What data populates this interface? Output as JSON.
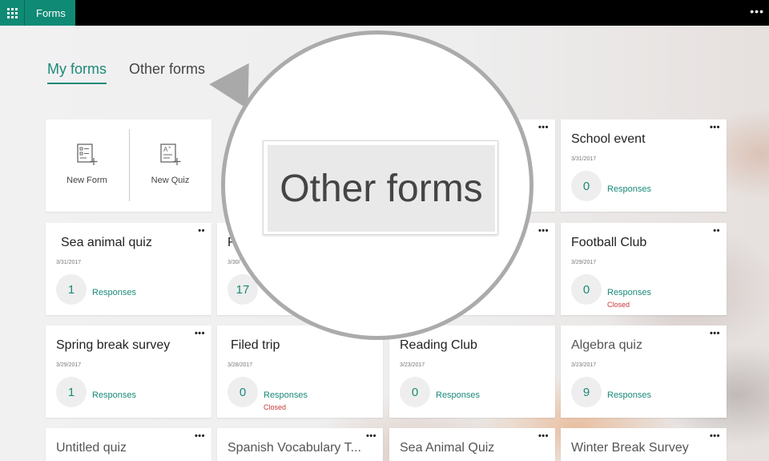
{
  "app": {
    "name": "Forms"
  },
  "tabs": [
    {
      "label": "My forms",
      "active": true
    },
    {
      "label": "Other forms",
      "active": false
    }
  ],
  "new_card": {
    "new_form": "New Form",
    "new_quiz": "New Quiz"
  },
  "magnifier": {
    "text": "Other forms"
  },
  "cards": [
    {
      "title": "School event",
      "date": "3/31/2017",
      "count": "0",
      "responses": "Responses"
    },
    {
      "title": "Sea animal quiz",
      "date": "3/31/2017",
      "count": "1",
      "responses": "Responses"
    },
    {
      "title": "F",
      "date": "3/30/",
      "count": "17",
      "responses": ""
    },
    {
      "title": "Football Club",
      "date": "3/29/2017",
      "count": "0",
      "responses": "Responses",
      "closed": "Closed"
    },
    {
      "title": "Spring break survey",
      "date": "3/29/2017",
      "count": "1",
      "responses": "Responses"
    },
    {
      "title": "Filed trip",
      "date": "3/28/2017",
      "count": "0",
      "responses": "Responses",
      "closed": "Closed"
    },
    {
      "title": "Reading Club",
      "date": "3/23/2017",
      "count": "0",
      "responses": "Responses"
    },
    {
      "title": "Algebra quiz",
      "date": "3/23/2017",
      "count": "9",
      "responses": "Responses"
    },
    {
      "title": "Untitled quiz"
    },
    {
      "title": "Spanish Vocabulary T..."
    },
    {
      "title": "Sea Animal Quiz"
    },
    {
      "title": "Winter Break Survey"
    }
  ],
  "colors": {
    "brand": "#0f8a75",
    "accent": "#1a8a78",
    "closed": "#c8373a"
  },
  "icons": {
    "waffle": "app-launcher-icon",
    "more": "more-icon"
  }
}
